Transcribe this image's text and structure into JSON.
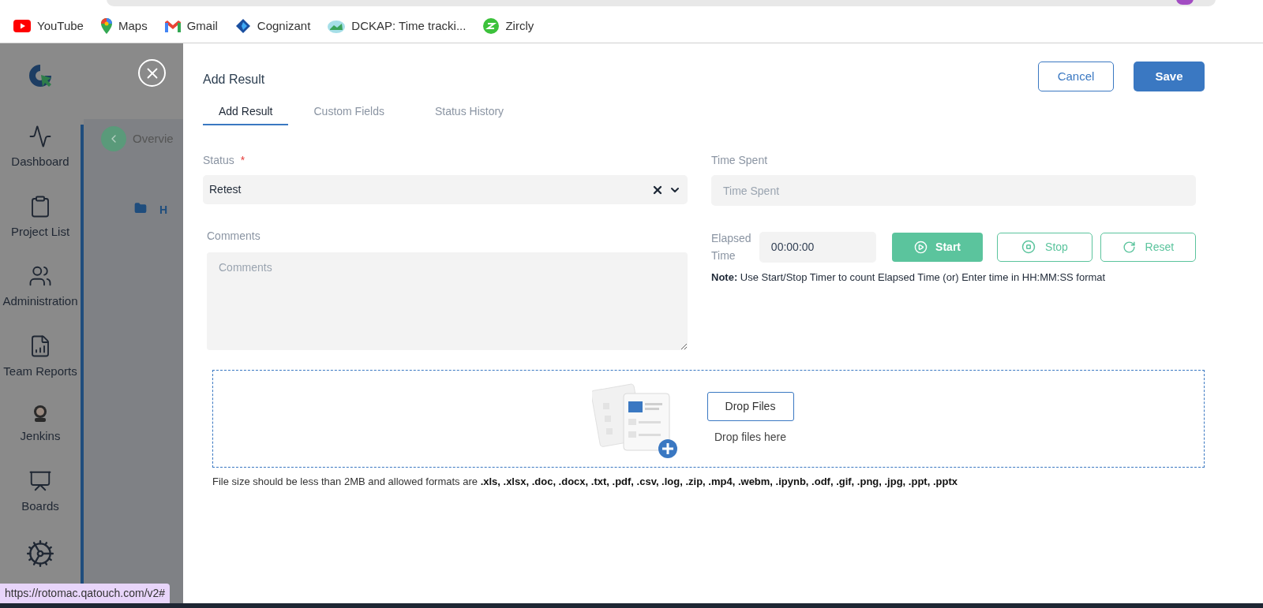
{
  "bookmarks": [
    {
      "label": "YouTube"
    },
    {
      "label": "Maps"
    },
    {
      "label": "Gmail"
    },
    {
      "label": "Cognizant"
    },
    {
      "label": "DCKAP: Time tracki..."
    },
    {
      "label": "Zircly"
    }
  ],
  "sidebar": {
    "items": [
      {
        "label": "Dashboard"
      },
      {
        "label": "Project List"
      },
      {
        "label": "Administration"
      },
      {
        "label": "Team Reports"
      },
      {
        "label": "Jenkins"
      },
      {
        "label": "Boards"
      }
    ]
  },
  "background_page": {
    "breadcrumb": "Overvie",
    "folder_label": "H"
  },
  "drawer": {
    "title": "Add Result",
    "cancel_button": "Cancel",
    "save_button": "Save",
    "tabs": [
      {
        "label": "Add Result",
        "selected": true
      },
      {
        "label": "Custom Fields",
        "selected": false
      },
      {
        "label": "Status History",
        "selected": false
      }
    ],
    "status": {
      "label": "Status",
      "required_mark": "*",
      "value": "Retest"
    },
    "comments": {
      "label": "Comments",
      "placeholder": "Comments"
    },
    "time_spent": {
      "label": "Time Spent",
      "placeholder": "Time Spent"
    },
    "elapsed_time": {
      "label": "Elapsed Time",
      "value": "00:00:00",
      "start_button": "Start",
      "stop_button": "Stop",
      "reset_button": "Reset"
    },
    "note": "**Note:** Use Start/Stop Timer to count Elapsed Time (or) Enter time in HH:MM:SS format",
    "dropzone": {
      "button": "Drop Files",
      "hint": "Drop files here"
    },
    "file_note": "File size should be less than 2MB and allowed formats are **.xls, .xlsx, .doc, .docx, .txt, .pdf, .csv, .log, .zip, .mp4, .webm, .ipynb, .odf, .gif, .png, .jpg, .ppt, .pptx**"
  },
  "status_url": "https://rotomac.qatouch.com/v2#"
}
